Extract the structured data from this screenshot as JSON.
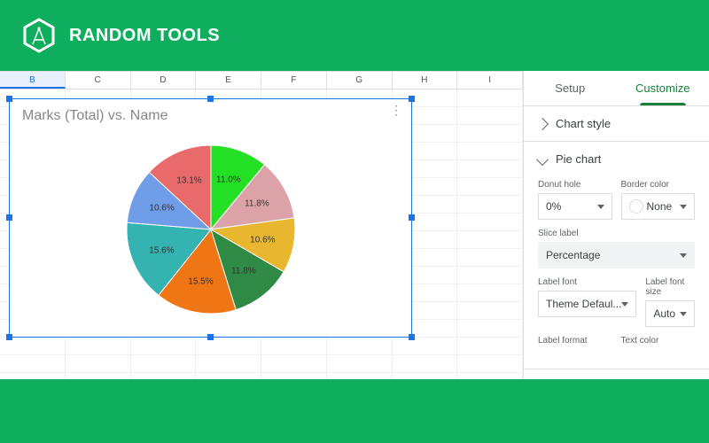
{
  "brand": "RANDOM TOOLS",
  "columns": [
    "B",
    "C",
    "D",
    "E",
    "F",
    "G",
    "H",
    "I"
  ],
  "selected_column_index": 0,
  "chart_title": "Marks (Total) vs. Name",
  "chart_data": {
    "type": "pie",
    "title": "Marks (Total) vs. Name",
    "slices": [
      {
        "pct": 11.0,
        "color": "#24e024",
        "label": "11.0%"
      },
      {
        "pct": 11.8,
        "color": "#dba3a7",
        "label": "11.8%"
      },
      {
        "pct": 10.6,
        "color": "#e8b72f",
        "label": "10.6%"
      },
      {
        "pct": 11.8,
        "color": "#2f8a45",
        "label": "11.8%"
      },
      {
        "pct": 15.5,
        "color": "#f07514",
        "label": "15.5%"
      },
      {
        "pct": 15.6,
        "color": "#34b3b0",
        "label": "15.6%"
      },
      {
        "pct": 10.6,
        "color": "#6f9de8",
        "label": "10.6%"
      },
      {
        "pct": 13.1,
        "color": "#e86a6a",
        "label": "13.1%"
      }
    ]
  },
  "side": {
    "tabs": {
      "setup": "Setup",
      "customize": "Customize"
    },
    "sections": {
      "chart_style": "Chart style",
      "pie_chart": "Pie chart"
    },
    "fields": {
      "donut_hole": {
        "label": "Donut hole",
        "value": "0%"
      },
      "border_color": {
        "label": "Border color",
        "value": "None"
      },
      "slice_label": {
        "label": "Slice label",
        "value": "Percentage"
      },
      "label_font": {
        "label": "Label font",
        "value": "Theme Defaul..."
      },
      "label_font_size": {
        "label": "Label font size",
        "value": "Auto"
      },
      "label_format": {
        "label": "Label format"
      },
      "text_color": {
        "label": "Text color"
      }
    }
  }
}
